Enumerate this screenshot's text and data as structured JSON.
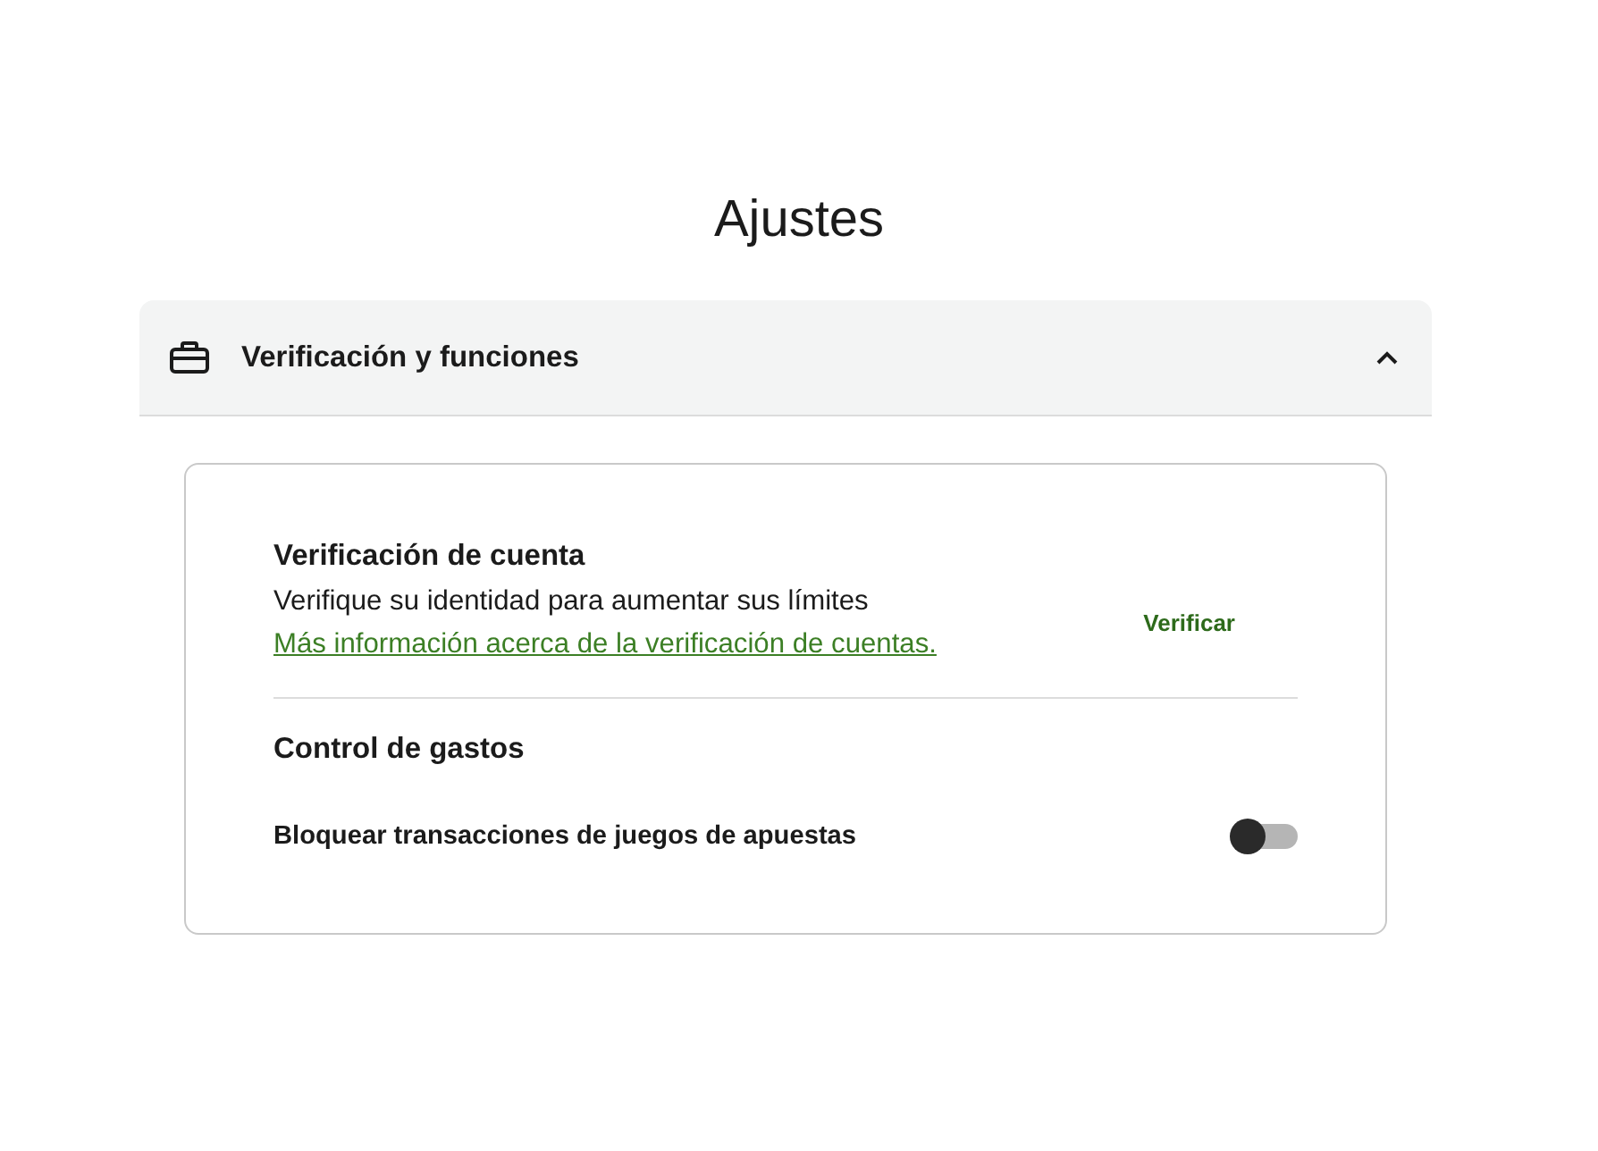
{
  "page": {
    "title": "Ajustes"
  },
  "section": {
    "title": "Verificación y funciones",
    "expanded": true
  },
  "account_verification": {
    "title": "Verificación de cuenta",
    "description": "Verifique su identidad para aumentar sus límites",
    "link": "Más información acerca de la verificación de cuentas.",
    "button": "Verificar"
  },
  "spending_control": {
    "title": "Control de gastos",
    "settings": [
      {
        "label": "Bloquear transacciones de juegos de apuestas",
        "on": false
      }
    ]
  }
}
